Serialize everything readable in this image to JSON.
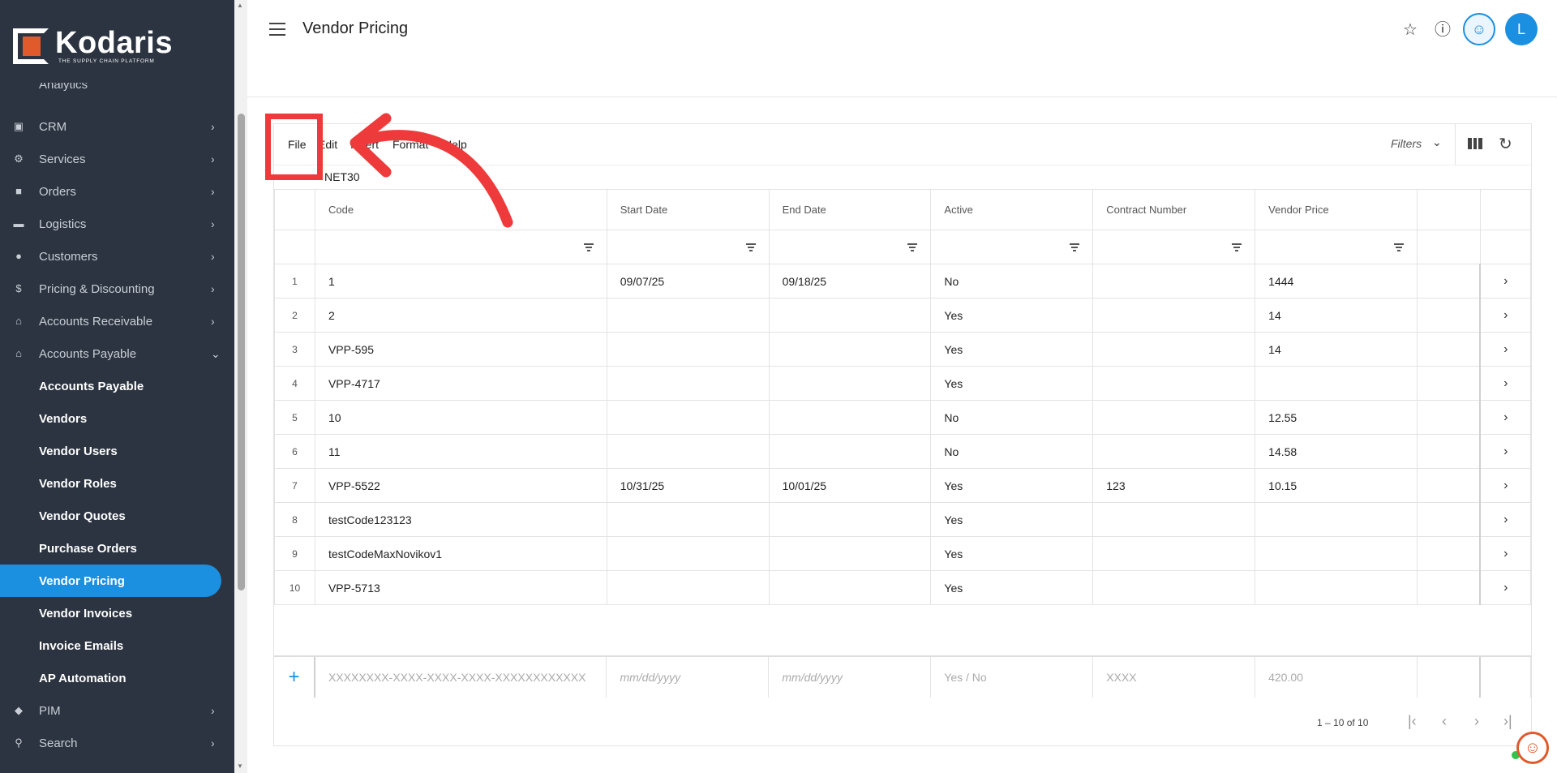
{
  "app": {
    "brand": "Kodaris",
    "tagline": "THE SUPPLY CHAIN PLATFORM"
  },
  "header": {
    "title": "Vendor Pricing",
    "user_initial": "L"
  },
  "sidebar": {
    "cut_item": "Analytics",
    "items": [
      {
        "label": "CRM",
        "icon": "briefcase-icon"
      },
      {
        "label": "Services",
        "icon": "gears-icon"
      },
      {
        "label": "Orders",
        "icon": "truck-icon"
      },
      {
        "label": "Logistics",
        "icon": "shipping-icon"
      },
      {
        "label": "Customers",
        "icon": "people-icon"
      },
      {
        "label": "Pricing & Discounting",
        "icon": "dollar-icon"
      },
      {
        "label": "Accounts Receivable",
        "icon": "bank-icon"
      },
      {
        "label": "Accounts Payable",
        "icon": "bank-icon"
      }
    ],
    "subitems": [
      "Accounts Payable",
      "Vendors",
      "Vendor Users",
      "Vendor Roles",
      "Vendor Quotes",
      "Purchase Orders",
      "Vendor Pricing",
      "Vendor Invoices",
      "Invoice Emails",
      "AP Automation"
    ],
    "bottom_items": [
      {
        "label": "PIM",
        "icon": "tag-icon"
      },
      {
        "label": "Search",
        "icon": "search-icon"
      }
    ],
    "active": "Vendor Pricing"
  },
  "grid": {
    "menu": [
      "File",
      "Edit",
      "Insert",
      "Format",
      "Help"
    ],
    "filters_label": "Filters",
    "breadcrumb": "NET30",
    "columns": [
      "Code",
      "Start Date",
      "End Date",
      "Active",
      "Contract Number",
      "Vendor Price"
    ],
    "rows": [
      {
        "n": "1",
        "code": "1",
        "start": "09/07/25",
        "end": "09/18/25",
        "active": "No",
        "contract": "",
        "price": "1444"
      },
      {
        "n": "2",
        "code": "2",
        "start": "",
        "end": "",
        "active": "Yes",
        "contract": "",
        "price": "14"
      },
      {
        "n": "3",
        "code": "VPP-595",
        "start": "",
        "end": "",
        "active": "Yes",
        "contract": "",
        "price": "14"
      },
      {
        "n": "4",
        "code": "VPP-4717",
        "start": "",
        "end": "",
        "active": "Yes",
        "contract": "",
        "price": ""
      },
      {
        "n": "5",
        "code": "10",
        "start": "",
        "end": "",
        "active": "No",
        "contract": "",
        "price": "12.55"
      },
      {
        "n": "6",
        "code": "11",
        "start": "",
        "end": "",
        "active": "No",
        "contract": "",
        "price": "14.58"
      },
      {
        "n": "7",
        "code": "VPP-5522",
        "start": "10/31/25",
        "end": "10/01/25",
        "active": "Yes",
        "contract": "123",
        "price": "10.15"
      },
      {
        "n": "8",
        "code": "testCode123123",
        "start": "",
        "end": "",
        "active": "Yes",
        "contract": "",
        "price": ""
      },
      {
        "n": "9",
        "code": "testCodeMaxNovikov1",
        "start": "",
        "end": "",
        "active": "Yes",
        "contract": "",
        "price": ""
      },
      {
        "n": "10",
        "code": "VPP-5713",
        "start": "",
        "end": "",
        "active": "Yes",
        "contract": "",
        "price": ""
      }
    ],
    "new_row": {
      "code": "XXXXXXXX-XXXX-XXXX-XXXX-XXXXXXXXXXXX",
      "start": "mm/dd/yyyy",
      "end": "mm/dd/yyyy",
      "active": "Yes / No",
      "contract": "XXXX",
      "price": "420.00"
    },
    "pagination": "1 – 10 of 10"
  },
  "colors": {
    "sidebar_bg": "#2b3440",
    "accent": "#1b8fe0",
    "annotation": "#ee3a3a",
    "brand_orange": "#e05a2b"
  }
}
